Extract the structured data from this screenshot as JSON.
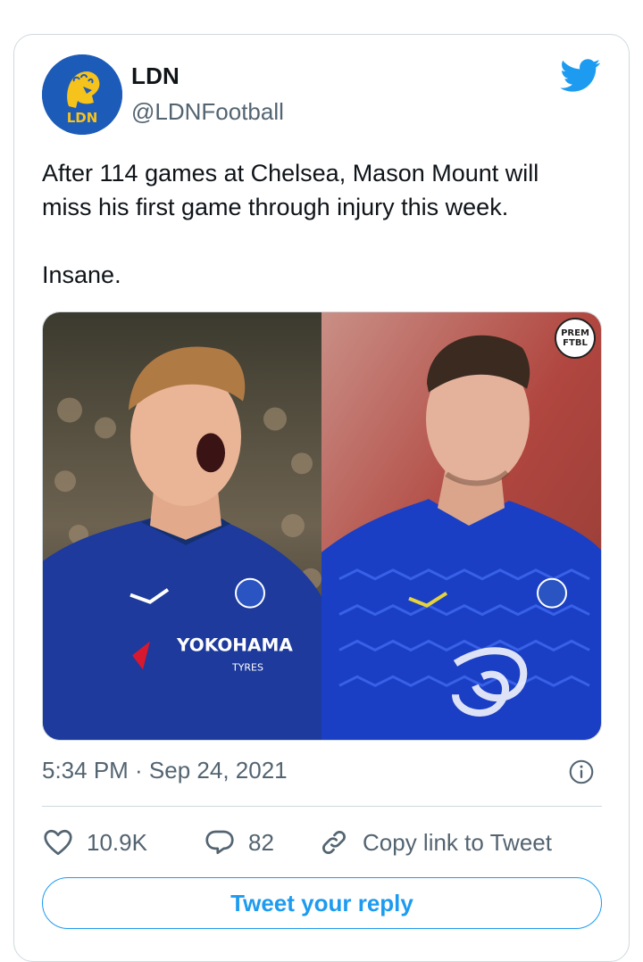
{
  "tweet": {
    "author": {
      "display_name": "LDN",
      "handle": "@LDNFootball",
      "avatar_text": "LDN",
      "avatar_color": "#1d5bb8"
    },
    "text_lines": [
      "After 114 games at Chelsea, Mason Mount will",
      "miss his first game through injury this week."
    ],
    "text_line2": "Insane.",
    "media": {
      "watermark_line1": "PREM",
      "watermark_line2": "FTBL"
    },
    "timestamp": "5:34 PM · Sep 24, 2021",
    "actions": {
      "likes": "10.9K",
      "replies": "82",
      "copy_link": "Copy link to Tweet"
    },
    "reply_button": "Tweet your reply"
  },
  "colors": {
    "accent": "#1d9bf0",
    "muted_text": "#536471",
    "border": "#cfd9de"
  },
  "icons": [
    "twitter-bird-icon",
    "info-icon",
    "heart-icon",
    "reply-bubble-icon",
    "link-icon"
  ]
}
